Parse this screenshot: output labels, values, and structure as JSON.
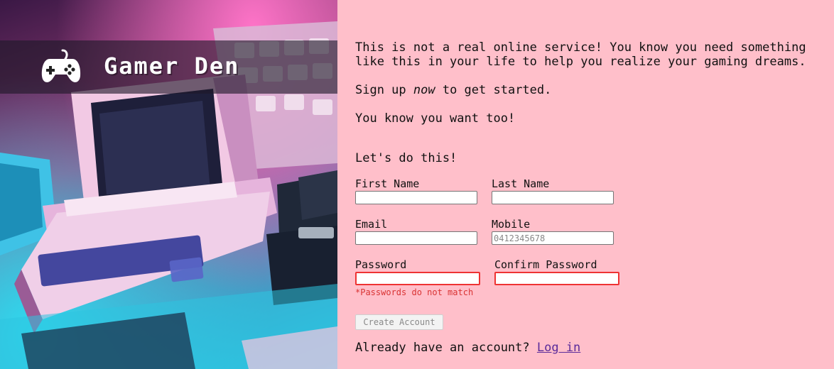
{
  "brand": {
    "title": "Gamer Den"
  },
  "intro": {
    "line1": "This is not a real online service! You know you need something like this in your life to help you realize your gaming dreams.",
    "signup_prefix": "Sign up ",
    "signup_emphasis": "now",
    "signup_suffix": " to get started.",
    "line3": "You know you want too!"
  },
  "form": {
    "heading": "Let's do this!",
    "first_name": {
      "label": "First Name",
      "value": "",
      "placeholder": ""
    },
    "last_name": {
      "label": "Last Name",
      "value": "",
      "placeholder": ""
    },
    "email": {
      "label": "Email",
      "value": "",
      "placeholder": ""
    },
    "mobile": {
      "label": "Mobile",
      "value": "",
      "placeholder": "0412345678"
    },
    "password": {
      "label": "Password",
      "value": ""
    },
    "confirm_password": {
      "label": "Confirm Password",
      "value": ""
    },
    "password_error": "*Passwords do not match",
    "create_button": "Create Account"
  },
  "login": {
    "prompt": "Already have an account? ",
    "link": "Log in"
  },
  "colors": {
    "page_background": "#ffbfca",
    "error": "#e33333",
    "link": "#5a2a9a"
  },
  "icons": {
    "brand": "gamepad-icon"
  }
}
